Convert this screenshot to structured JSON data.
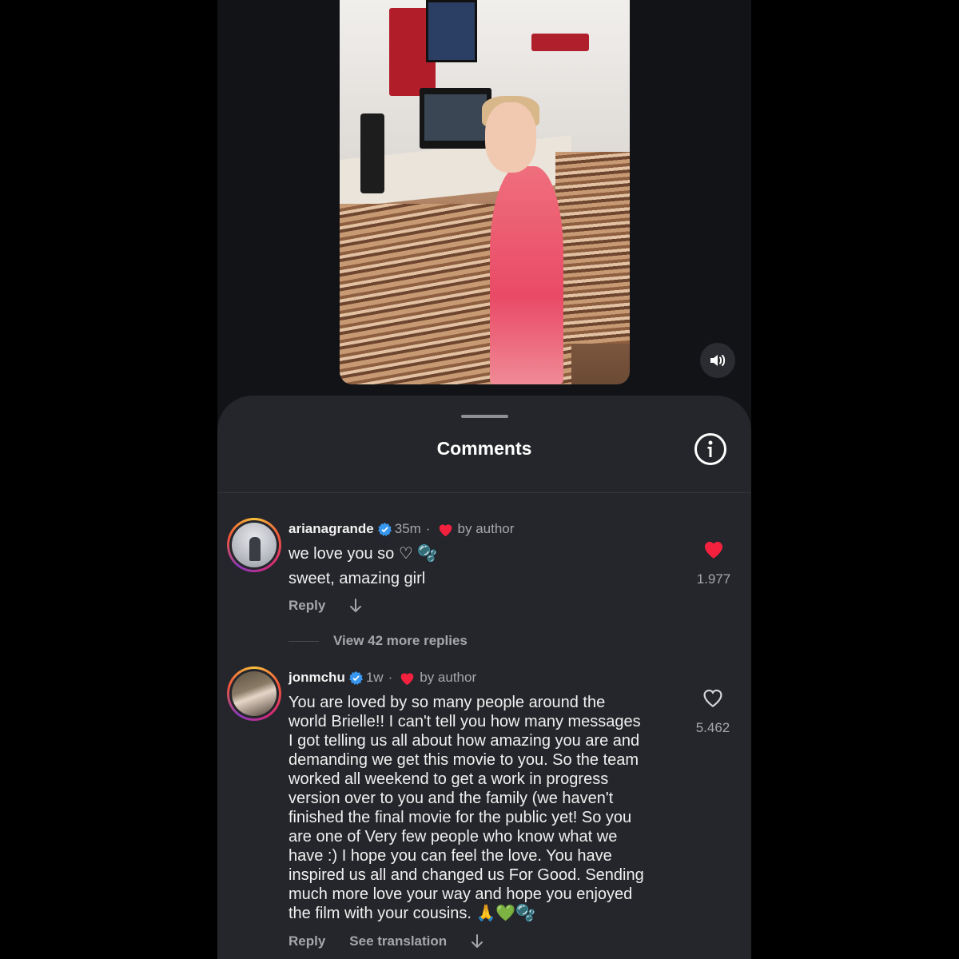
{
  "video": {
    "sound_icon": "speaker-icon"
  },
  "sheet": {
    "title": "Comments",
    "info_icon": "info-icon"
  },
  "comments": [
    {
      "username": "arianagrande",
      "time": "35m",
      "dot": "·",
      "liked_by": "by author",
      "lines": [
        "we love you so ♡ 🫧",
        "sweet, amazing girl"
      ],
      "reply": "Reply",
      "likes": "1.977",
      "liked": true,
      "view_more": "View 42 more replies"
    },
    {
      "username": "jonmchu",
      "time": "1w",
      "dot": "·",
      "liked_by": "by author",
      "lines": [
        "You are loved by so many people around the",
        "world Brielle!! I can't tell you how many messages",
        "I got telling us all about how amazing you are and",
        "demanding we get this movie to you. So the team",
        "worked all weekend to get a work in progress",
        "version over to you and the family (we haven't",
        "finished the final movie for the public yet! So you",
        "are one of Very few people who know what we",
        "have :) I hope you can feel the love. You have",
        "inspired us all and changed us For Good. Sending",
        "much more love your way and hope you enjoyed",
        "the film with your cousins. 🙏💚🫧"
      ],
      "reply": "Reply",
      "see_translation": "See translation",
      "likes": "5.462",
      "liked": false
    }
  ],
  "colors": {
    "like_red": "#f3213d",
    "verified_blue": "#3897f0",
    "sheet_bg": "#25262b"
  }
}
